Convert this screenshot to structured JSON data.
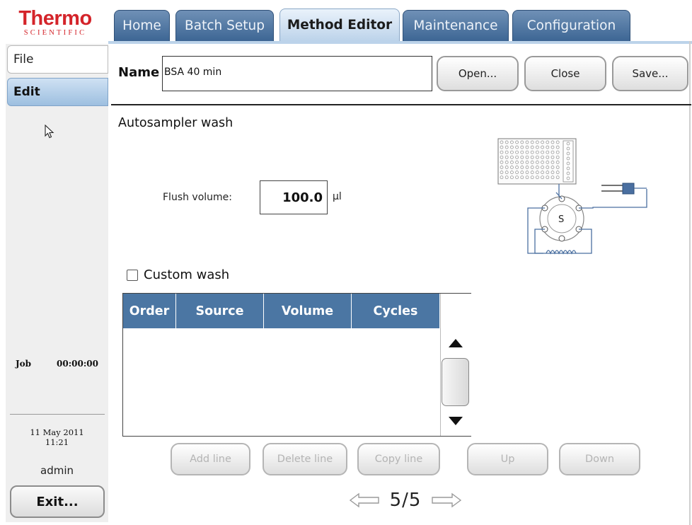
{
  "brand": {
    "line1": "Thermo",
    "line2": "SCIENTIFIC"
  },
  "tabs": [
    {
      "label": "Home",
      "active": false
    },
    {
      "label": "Batch Setup",
      "active": false
    },
    {
      "label": "Method Editor",
      "active": true
    },
    {
      "label": "Maintenance",
      "active": false
    },
    {
      "label": "Configuration",
      "active": false
    }
  ],
  "sidebar": {
    "file_label": "File",
    "edit_label": "Edit",
    "job_label": "Job",
    "job_time": "00:00:00",
    "date": "11 May 2011",
    "time": "11:21",
    "user": "admin",
    "exit_label": "Exit..."
  },
  "method": {
    "name_label": "Name",
    "name_value": "BSA 40 min",
    "open_label": "Open...",
    "close_label": "Close",
    "save_label": "Save..."
  },
  "wash": {
    "section_title": "Autosampler wash",
    "flush_label": "Flush volume:",
    "flush_value": "100.0",
    "flush_unit": "µl",
    "custom_wash_label": "Custom wash",
    "custom_wash_checked": false,
    "diagram_valve_label": "S"
  },
  "table": {
    "columns": [
      "Order",
      "Source",
      "Volume",
      "Cycles"
    ],
    "rows": []
  },
  "actions": {
    "add_line": "Add line",
    "delete_line": "Delete line",
    "copy_line": "Copy line",
    "up": "Up",
    "down": "Down"
  },
  "pager": {
    "text": "5/5"
  },
  "colors": {
    "brand_red": "#d4242a",
    "tab_blue": "#3d6694",
    "header_blue": "#4b76a3",
    "active_tab": "#bcd3ea"
  }
}
